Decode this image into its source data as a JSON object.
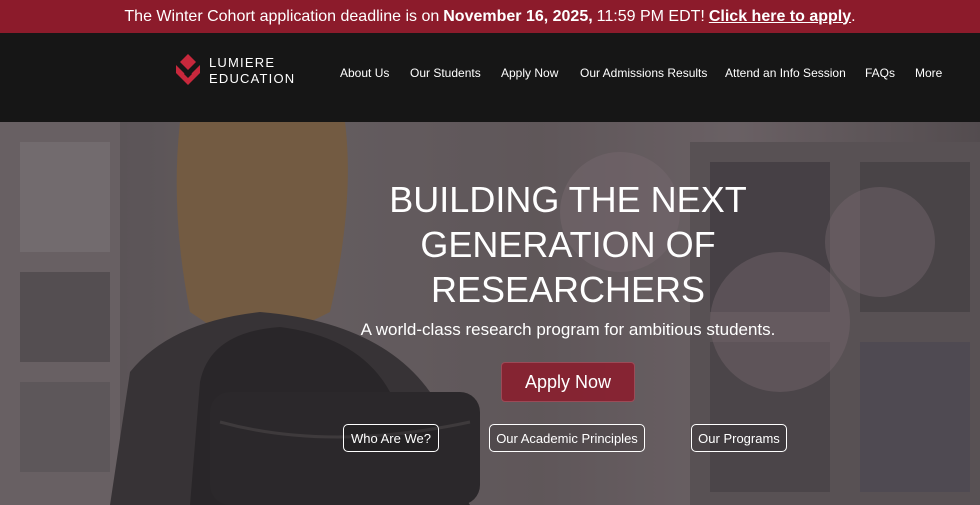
{
  "announcement": {
    "prefix": "The Winter Cohort application deadline is on",
    "date": "November 16, 2025,",
    "time": "11:59 PM EDT!",
    "link": "Click here to apply",
    "suffix": "."
  },
  "brand": {
    "line1": "LUMIERE",
    "line2": "EDUCATION",
    "accent": "#c8283c"
  },
  "nav": {
    "items": [
      "About Us",
      "Our Students",
      "Apply Now",
      "Our Admissions Results",
      "Attend an Info Session",
      "FAQs",
      "More"
    ]
  },
  "hero": {
    "title_lines": [
      "BUILDING THE NEXT",
      "GENERATION OF",
      "RESEARCHERS"
    ],
    "subtitle": "A world-class research program for ambitious students.",
    "cta": "Apply Now",
    "pills": [
      "Who Are We?",
      "Our Academic Principles",
      "Our Programs"
    ]
  }
}
